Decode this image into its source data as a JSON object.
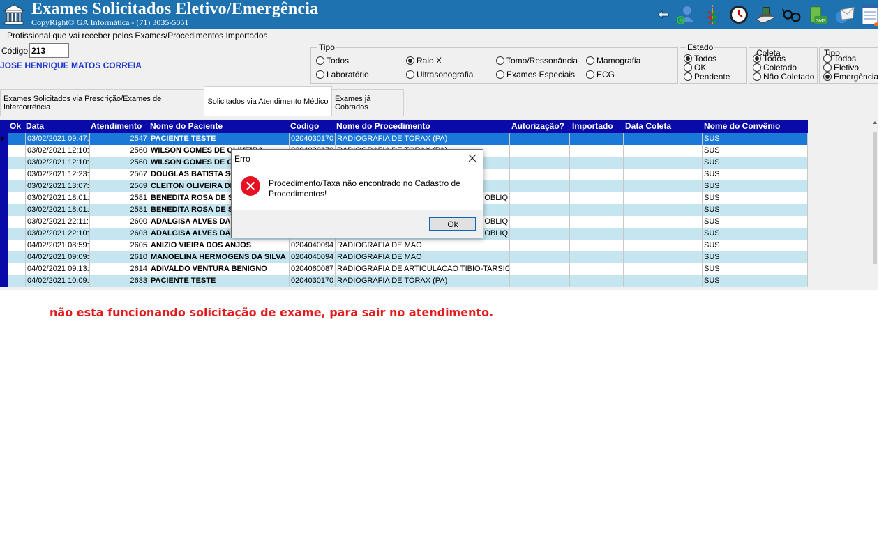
{
  "title": {
    "main": "Exames Solicitados Eletivo/Emergência",
    "copyright": "CopyRight© GA Informática - (71) 3035-5051"
  },
  "toolbar": {
    "icons": [
      "back-arrow-icon",
      "add-user-icon",
      "caduceus-icon",
      "clock-icon",
      "document-stamp-icon",
      "glasses-icon",
      "sms-phone-icon",
      "envelope-globe-icon",
      "form-icon"
    ]
  },
  "header": {
    "profissional_label": "Profissional  que vai receber pelos Exames/Procedimentos Importados",
    "codigo_label": "Código",
    "codigo_value": "213",
    "doctor_name": "JOSE HENRIQUE MATOS CORREIA"
  },
  "tipo": {
    "legend": "Tipo",
    "options": [
      "Todos",
      "Raio X",
      "Tomo/Ressonância",
      "Mamografia",
      "Laboratório",
      "Ultrasonografia",
      "Exames Especiais",
      "ECG"
    ],
    "selected": "Raio X"
  },
  "estado": {
    "legend": "Estado",
    "options": [
      "Todos",
      "OK",
      "Pendente"
    ],
    "selected": "Todos"
  },
  "coleta": {
    "legend": "Coleta",
    "options": [
      "Todos",
      "Coletado",
      "Não Coletado"
    ],
    "selected": "Todos"
  },
  "tipo2": {
    "legend": "Tipo",
    "options": [
      "Todos",
      "Eletivo",
      "Emergência"
    ],
    "selected": "Emergência"
  },
  "tabs": [
    {
      "label": "Exames Solicitados via Prescrição/Exames de Intercorrência"
    },
    {
      "label": "Solicitados via Atendimento Médico",
      "active": true
    },
    {
      "label": "Exames já Cobrados"
    }
  ],
  "grid": {
    "headers": [
      "Ok",
      "Data",
      "Atendimento",
      "Nome do Paciente",
      "Codigo",
      "Nome do Procedimento",
      "Autorização?",
      "Importado",
      "Data Coleta",
      "Nome do Convênio"
    ],
    "rows": [
      [
        "03/02/2021 09:47:",
        "2547",
        "PACIENTE TESTE",
        "0204030170",
        "RADIOGRAFIA DE TORAX (PA)",
        "SUS"
      ],
      [
        "03/02/2021 12:10:(",
        "2560",
        "WILSON GOMES DE OLIVEIRA",
        "0204030170",
        "RADIOGRAFIA DE TORAX (PA)",
        "SUS"
      ],
      [
        "03/02/2021 12:10:1",
        "2560",
        "WILSON GOMES DE OL",
        "",
        "",
        "SUS"
      ],
      [
        "03/02/2021 12:23:",
        "2567",
        "DOUGLAS BATISTA SO",
        "",
        "",
        "SUS"
      ],
      [
        "03/02/2021 13:07:4",
        "2569",
        "CLEITON OLIVEIRA DE",
        "",
        "",
        "SUS"
      ],
      [
        "03/02/2021 18:01:5",
        "2581",
        "BENEDITA ROSA DE SO",
        "",
        "+ OBLIQ",
        "SUS"
      ],
      [
        "03/02/2021 18:01:5",
        "2581",
        "BENEDITA ROSA DE SO",
        "",
        "",
        "SUS"
      ],
      [
        "03/02/2021 22:11:",
        "2600",
        "ADALGISA ALVES DA",
        "",
        "+ OBLIQ",
        "SUS"
      ],
      [
        "03/02/2021 22:10:5",
        "2603",
        "ADALGISA ALVES DA",
        "",
        "+ OBLIQ",
        "SUS"
      ],
      [
        "04/02/2021 08:59:1",
        "2605",
        "ANIZIO VIEIRA DOS ANJOS",
        "0204040094",
        "RADIOGRAFIA DE MAO",
        "SUS"
      ],
      [
        "04/02/2021 09:09:(",
        "2610",
        "MANOELINA HERMOGENS DA SILVA",
        "0204040094",
        "RADIOGRAFIA DE MAO",
        "SUS"
      ],
      [
        "04/02/2021 09:13:",
        "2614",
        "ADIVALDO VENTURA BENIGNO",
        "0204060087",
        "RADIOGRAFIA DE ARTICULACAO TIBIO-TARSICA",
        "SUS"
      ],
      [
        "04/02/2021 10:09:",
        "2633",
        "PACIENTE TESTE",
        "0204030170",
        "RADIOGRAFIA DE TORAX (PA)",
        "SUS"
      ]
    ]
  },
  "dialog": {
    "title": "Erro",
    "message": "Procedimento/Taxa não encontrado no Cadastro de Procedimentos!",
    "ok_label": "Ok"
  },
  "annotation": "não esta funcionando solicitação de exame, para sair no atendimento.",
  "colors": {
    "titlebar": "#1e72b0",
    "grid_header": "#0a0aa8",
    "selected_row": "#1a78d8",
    "alt_row": "#c5e6f0",
    "doctor_name": "#1a35d0",
    "annotation": "#e31b1b"
  }
}
